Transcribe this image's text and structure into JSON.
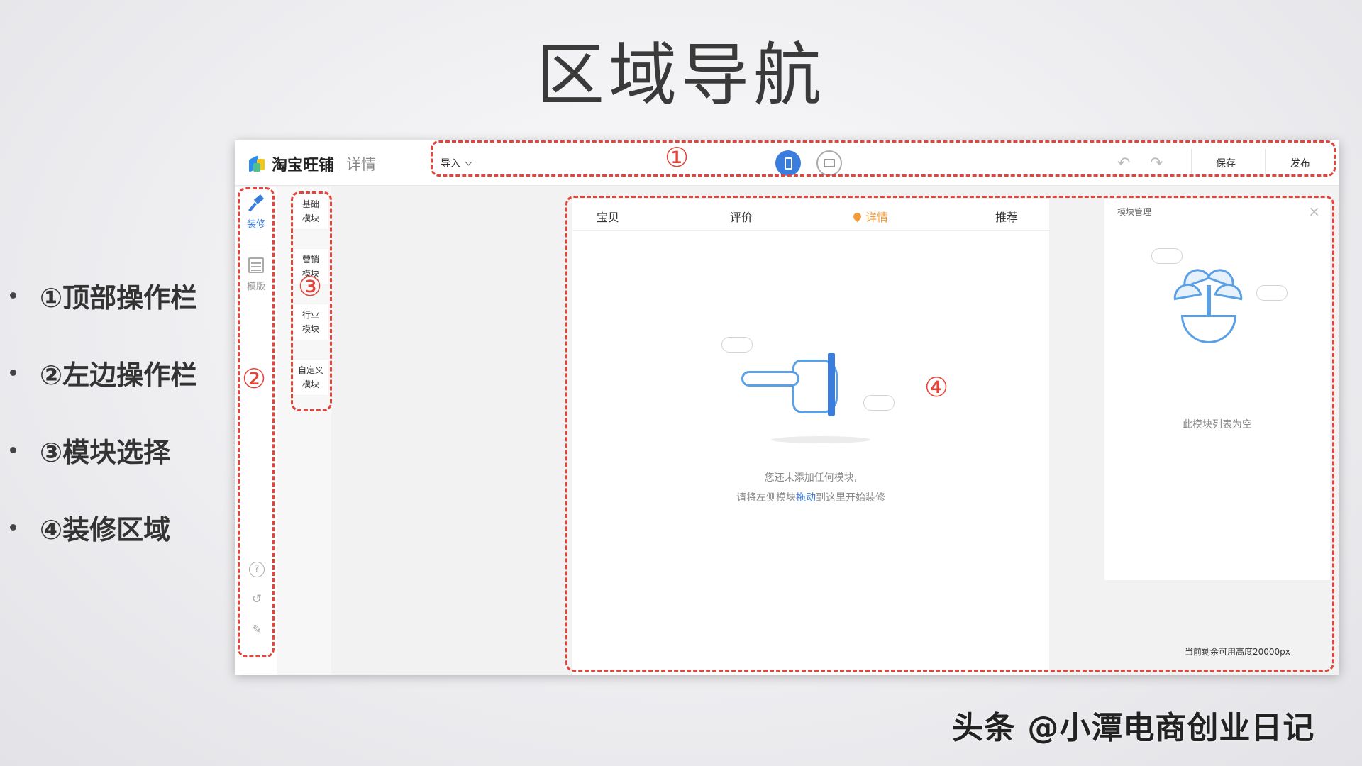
{
  "slide": {
    "title": "区域导航",
    "bullets": [
      "①顶部操作栏",
      "②左边操作栏",
      "③模块选择",
      "④装修区域"
    ]
  },
  "app": {
    "logo_text": "淘宝旺铺",
    "logo_sub": "详情",
    "import_label": "导入",
    "save_label": "保存",
    "publish_label": "发布",
    "sidebar": {
      "decorate": "装修",
      "template": "模版"
    },
    "modules": [
      "基础\n模块",
      "营销\n模块",
      "行业\n模块",
      "自定义\n模块"
    ],
    "tabs": [
      "宝贝",
      "评价",
      "详情",
      "推荐"
    ],
    "active_tab": "详情",
    "empty_line1": "您还未添加任何模块,",
    "empty_line2_pre": "请将左侧模块",
    "empty_line2_link": "拖动",
    "empty_line2_post": "到这里开始装修",
    "right_panel": {
      "title": "模块管理",
      "empty": "此模块列表为空"
    },
    "height_note": "当前剩余可用高度20000px"
  },
  "annotations": [
    "①",
    "②",
    "③",
    "④"
  ],
  "watermark": "头条 @小潭电商创业日记",
  "colors": {
    "annotation": "#e4453a",
    "accent_blue": "#3b7ddd",
    "active_tab": "#f29b38"
  }
}
